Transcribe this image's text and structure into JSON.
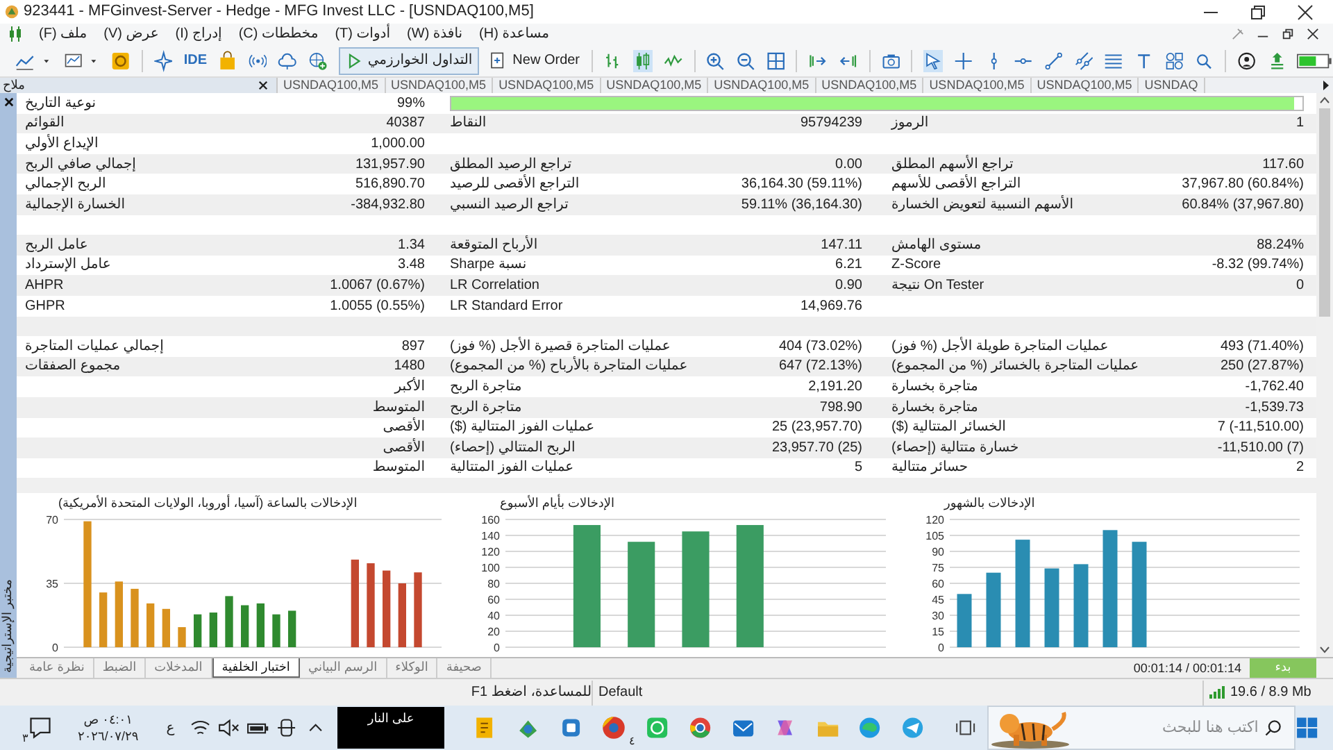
{
  "window": {
    "title": "923441 - MFGinvest-Server - Hedge - MFG Invest LLC - [USNDAQ100,M5]"
  },
  "menu": [
    "مساعدة (H)",
    "نافذة (W)",
    "أدوات (T)",
    "مخططات (C)",
    "إدراج (I)",
    "عرض (V)",
    "ملف (F)"
  ],
  "toolbar": {
    "ide": "IDE",
    "algo_trading": "التداول الخوارزمي",
    "new_order": "New Order"
  },
  "navigator": {
    "title": "ملاح"
  },
  "chart_tabs": [
    "USNDAQ",
    "USNDAQ100,M5",
    "USNDAQ100,M5",
    "USNDAQ100,M5",
    "USNDAQ100,M5",
    "USNDAQ100,M5",
    "USNDAQ100,M5",
    "USNDAQ100,M5",
    "USNDAQ100,M5"
  ],
  "tester": {
    "title": "مختبر الإستراتيجية",
    "rows": [
      {
        "kind": "quality",
        "label_1": "نوعية التاريخ",
        "value_1": "99%",
        "level": 0.99
      },
      {
        "kind": "data",
        "label_1": "القوائم",
        "value_1": "40387",
        "label_2": "النقاط",
        "value_2": "95794239",
        "label_3": "الرموز",
        "value_3": "1"
      },
      {
        "kind": "data",
        "label_1": "الإيداع الأولي",
        "value_1": "1,000.00"
      },
      {
        "kind": "data",
        "label_1": "إجمالي صافي الربح",
        "value_1": "131,957.90",
        "label_2": "تراجع الرصيد المطلق",
        "value_2": "0.00",
        "label_3": "تراجع الأسهم المطلق",
        "value_3": "117.60"
      },
      {
        "kind": "data",
        "label_1": "الربح الإجمالي",
        "value_1": "516,890.70",
        "label_2": "التراجع الأقصى للرصيد",
        "value_2": "36,164.30 (59.11%)",
        "label_3": "التراجع الأقصى للأسهم",
        "value_3": "37,967.80 (60.84%)"
      },
      {
        "kind": "data",
        "label_1": "الخسارة الإجمالية",
        "value_1": "-384,932.80",
        "label_2": "تراجع الرصيد النسبي",
        "value_2": "59.11% (36,164.30)",
        "label_3": "الأسهم النسبية لتعويض الخسارة",
        "value_3": "60.84% (37,967.80)"
      },
      {
        "kind": "blank"
      },
      {
        "kind": "data",
        "label_1": "عامل الربح",
        "value_1": "1.34",
        "label_2": "الأرباح المتوقعة",
        "value_2": "147.11",
        "label_3": "مستوى الهامش",
        "value_3": "88.24%"
      },
      {
        "kind": "data",
        "label_1": "عامل الإسترداد",
        "value_1": "3.48",
        "label_2": "نسبة Sharpe",
        "value_2": "6.21",
        "label_3": "Z-Score",
        "value_3": "-8.32 (99.74%)"
      },
      {
        "kind": "data",
        "label_1": "AHPR",
        "value_1": "1.0067 (0.67%)",
        "label_2": "LR Correlation",
        "value_2": "0.90",
        "label_3": "On Tester نتيجة",
        "value_3": "0"
      },
      {
        "kind": "data",
        "label_1": "GHPR",
        "value_1": "1.0055 (0.55%)",
        "label_2": "LR Standard Error",
        "value_2": "14,969.76"
      },
      {
        "kind": "blank"
      },
      {
        "kind": "data",
        "label_1": "إجمالي عمليات المتاجرة",
        "value_1": "897",
        "label_2": "عمليات المتاجرة قصيرة الأجل (% فوز)",
        "value_2": "404 (73.02%)",
        "label_3": "عمليات المتاجرة طويلة الأجل (% فوز)",
        "value_3": "493 (71.40%)"
      },
      {
        "kind": "data",
        "label_1": "مجموع الصفقات",
        "value_1": "1480",
        "label_2": "عمليات المتاجرة بالأرباح (% من المجموع)",
        "value_2": "647 (72.13%)",
        "label_3": "عمليات المتاجرة بالخسائر (% من المجموع)",
        "value_3": "250 (27.87%)"
      },
      {
        "kind": "data",
        "value_1": "الأكبر",
        "label_2": "متاجرة الربح",
        "value_2": "2,191.20",
        "label_3": "متاجرة بخسارة",
        "value_3": "-1,762.40"
      },
      {
        "kind": "data",
        "value_1": "المتوسط",
        "label_2": "متاجرة الربح",
        "value_2": "798.90",
        "label_3": "متاجرة بخسارة",
        "value_3": "-1,539.73"
      },
      {
        "kind": "data",
        "value_1": "الأقصى",
        "label_2": "عمليات الفوز المتتالية ($)",
        "value_2": "25 (23,957.70)",
        "label_3": "الخسائر المتتالية ($)",
        "value_3": "7 (-11,510.00)"
      },
      {
        "kind": "data",
        "value_1": "الأقصى",
        "label_2": "الربح المتتالي (إحصاء)",
        "value_2": "23,957.70 (25)",
        "label_3": "خسارة متتالية (إحصاء)",
        "value_3": "-11,510.00 (7)"
      },
      {
        "kind": "data",
        "value_1": "المتوسط",
        "label_2": "عمليات الفوز المتتالية",
        "value_2": "5",
        "label_3": "حسائر متتالية",
        "value_3": "2"
      }
    ],
    "charts": [
      {
        "chart_data": {
          "type": "bar",
          "title": "الإدخالات بالشهور",
          "ylim": [
            0,
            120
          ],
          "yticks": [
            0,
            15,
            30,
            45,
            60,
            75,
            90,
            105,
            120
          ],
          "grid": true,
          "series": [
            {
              "color": "#2a8db2",
              "values": [
                50,
                70,
                101,
                74,
                78,
                110,
                99,
                null,
                null,
                null,
                null,
                null
              ]
            }
          ]
        }
      },
      {
        "chart_data": {
          "type": "bar",
          "title": "الإدخالات بأيام الأسبوع",
          "ylim": [
            0,
            160
          ],
          "yticks": [
            0,
            20,
            40,
            60,
            80,
            100,
            120,
            140,
            160
          ],
          "grid": true,
          "series": [
            {
              "color": "#3b9c62",
              "values": [
                null,
                153,
                132,
                145,
                153,
                null,
                null
              ]
            }
          ]
        }
      },
      {
        "chart_data": {
          "type": "bar",
          "title": "الإدخالات بالساعة (آسيا، أوروبا، الولايات المتحدة الأمريكية)",
          "ylim": [
            0,
            70
          ],
          "yticks": [
            0,
            35,
            70
          ],
          "grid": true,
          "series": [
            {
              "color": "#d9921e",
              "values": [
                null,
                69,
                30,
                36,
                32,
                24,
                21,
                11,
                null,
                null,
                null,
                null,
                null,
                null,
                null,
                null,
                null,
                null,
                null,
                null,
                null,
                null,
                null,
                null
              ]
            },
            {
              "color": "#2f8a2f",
              "values": [
                null,
                null,
                null,
                null,
                null,
                null,
                null,
                null,
                18,
                19,
                28,
                23,
                24,
                18,
                20,
                null,
                null,
                null,
                null,
                null,
                null,
                null,
                null,
                null
              ]
            },
            {
              "color": "#c4482f",
              "values": [
                null,
                null,
                null,
                null,
                null,
                null,
                null,
                null,
                null,
                null,
                null,
                null,
                null,
                null,
                null,
                null,
                null,
                null,
                48,
                46,
                42,
                35,
                41,
                null
              ]
            }
          ]
        }
      }
    ],
    "tabs": [
      {
        "label": "صحيفة",
        "selected": false
      },
      {
        "label": "الوكلاء",
        "selected": false
      },
      {
        "label": "الرسم البياني",
        "selected": false
      },
      {
        "label": "اختبار الخلفية",
        "selected": true
      },
      {
        "label": "المدخلات",
        "selected": false
      },
      {
        "label": "الضبط",
        "selected": false
      },
      {
        "label": "نظرة عامة",
        "selected": false
      }
    ],
    "elapsed": "00:01:14 / 00:01:14",
    "start_button": "بدء"
  },
  "status_bar": {
    "help": "للمساعدة، اضغط F1",
    "profile": "Default",
    "traffic": "19.6 / 8.9 Mb"
  },
  "taskbar": {
    "notifications": "٣",
    "time": "٠٤:٠١ ص",
    "date": "٢٠٢٦/٠٧/٢٩",
    "language": "ع",
    "widget": "على النار",
    "app_badge": "٤",
    "search": {
      "placeholder": "اكتب هنا للبحث"
    }
  }
}
